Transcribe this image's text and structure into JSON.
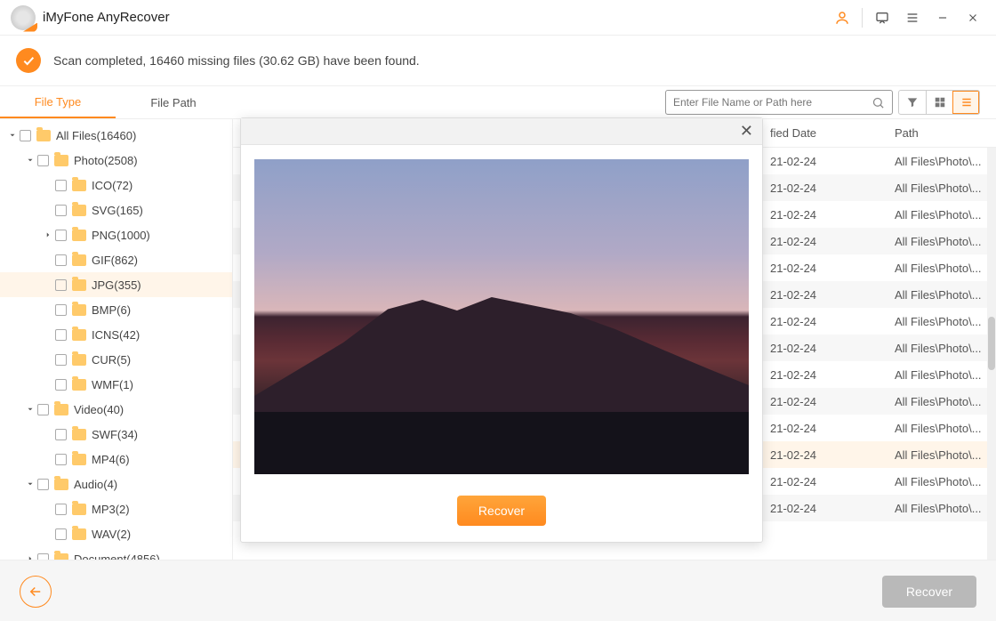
{
  "app": {
    "title": "iMyFone AnyRecover"
  },
  "banner": {
    "text": "Scan completed, 16460 missing files (30.62 GB) have been found."
  },
  "tabs": {
    "file_type": "File Type",
    "file_path": "File Path"
  },
  "search": {
    "placeholder": "Enter File Name or Path here"
  },
  "tree": [
    {
      "label": "All Files(16460)",
      "depth": 0,
      "caret": "down"
    },
    {
      "label": "Photo(2508)",
      "depth": 1,
      "caret": "down"
    },
    {
      "label": "ICO(72)",
      "depth": 2,
      "caret": ""
    },
    {
      "label": "SVG(165)",
      "depth": 2,
      "caret": ""
    },
    {
      "label": "PNG(1000)",
      "depth": 2,
      "caret": "right"
    },
    {
      "label": "GIF(862)",
      "depth": 2,
      "caret": ""
    },
    {
      "label": "JPG(355)",
      "depth": 2,
      "caret": "",
      "sel": true
    },
    {
      "label": "BMP(6)",
      "depth": 2,
      "caret": ""
    },
    {
      "label": "ICNS(42)",
      "depth": 2,
      "caret": ""
    },
    {
      "label": "CUR(5)",
      "depth": 2,
      "caret": ""
    },
    {
      "label": "WMF(1)",
      "depth": 2,
      "caret": ""
    },
    {
      "label": "Video(40)",
      "depth": 1,
      "caret": "down"
    },
    {
      "label": "SWF(34)",
      "depth": 2,
      "caret": ""
    },
    {
      "label": "MP4(6)",
      "depth": 2,
      "caret": ""
    },
    {
      "label": "Audio(4)",
      "depth": 1,
      "caret": "down"
    },
    {
      "label": "MP3(2)",
      "depth": 2,
      "caret": ""
    },
    {
      "label": "WAV(2)",
      "depth": 2,
      "caret": ""
    },
    {
      "label": "Document(4856)",
      "depth": 1,
      "caret": "right"
    }
  ],
  "columns": {
    "modified": "Modified Date",
    "path": "Path"
  },
  "col_modified_clip": "fied Date",
  "rows": [
    {
      "date": "21-02-24",
      "path": "All Files\\Photo\\..."
    },
    {
      "date": "21-02-24",
      "path": "All Files\\Photo\\..."
    },
    {
      "date": "21-02-24",
      "path": "All Files\\Photo\\..."
    },
    {
      "date": "21-02-24",
      "path": "All Files\\Photo\\..."
    },
    {
      "date": "21-02-24",
      "path": "All Files\\Photo\\..."
    },
    {
      "date": "21-02-24",
      "path": "All Files\\Photo\\..."
    },
    {
      "date": "21-02-24",
      "path": "All Files\\Photo\\..."
    },
    {
      "date": "21-02-24",
      "path": "All Files\\Photo\\..."
    },
    {
      "date": "21-02-24",
      "path": "All Files\\Photo\\..."
    },
    {
      "date": "21-02-24",
      "path": "All Files\\Photo\\..."
    },
    {
      "date": "21-02-24",
      "path": "All Files\\Photo\\..."
    },
    {
      "date": "21-02-24",
      "path": "All Files\\Photo\\...",
      "sel": true
    },
    {
      "date": "21-02-24",
      "path": "All Files\\Photo\\..."
    },
    {
      "date": "21-02-24",
      "path": "All Files\\Photo\\..."
    }
  ],
  "overlay": {
    "recover": "Recover"
  },
  "footer": {
    "recover": "Recover"
  }
}
